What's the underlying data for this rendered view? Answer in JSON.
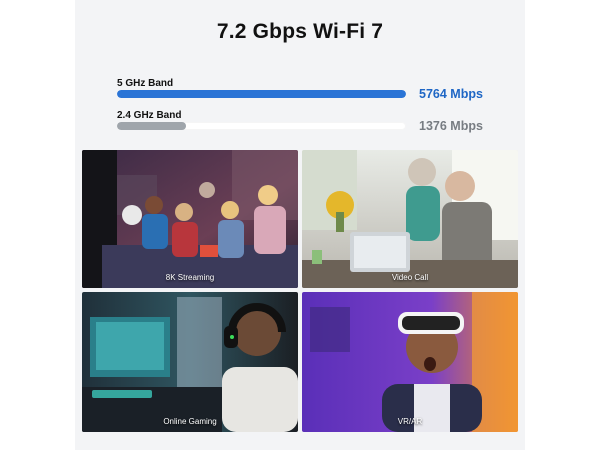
{
  "title": "7.2 Gbps Wi-Fi 7",
  "bands": [
    {
      "label": "5 GHz Band",
      "speed": "5764 Mbps",
      "fill": 1.0,
      "color": "#2a74d6",
      "speed_color": "#1e66c5"
    },
    {
      "label": "2.4 GHz Band",
      "speed": "1376 Mbps",
      "fill": 0.24,
      "color": "#9fa5ab",
      "speed_color": "#777c82"
    }
  ],
  "tiles": [
    {
      "caption": "8K Streaming",
      "image": "family-watching-tv-image"
    },
    {
      "caption": "Video Call",
      "image": "seniors-video-call-image"
    },
    {
      "caption": "Online Gaming",
      "image": "gamer-headset-image"
    },
    {
      "caption": "VR/AR",
      "image": "vr-headset-image"
    }
  ]
}
